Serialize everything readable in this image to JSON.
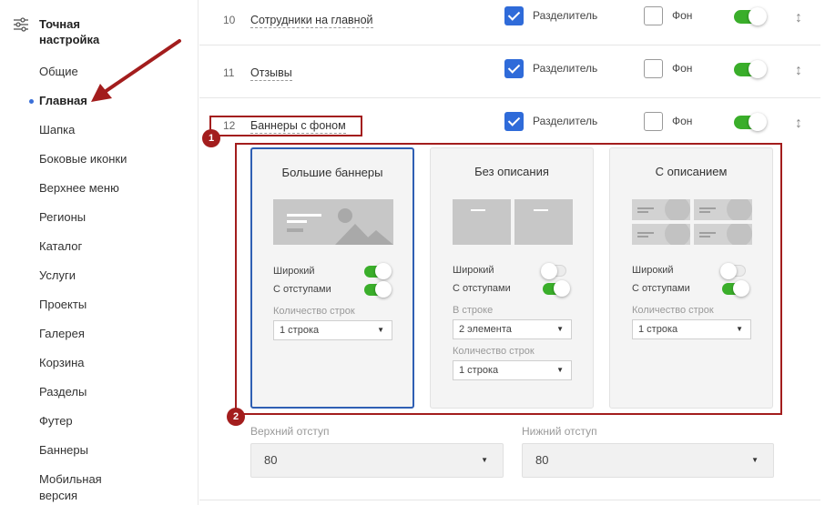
{
  "sidebar": {
    "title": "Точная настройка",
    "items": [
      {
        "label": "Общие",
        "active": false
      },
      {
        "label": "Главная",
        "active": true
      },
      {
        "label": "Шапка",
        "active": false
      },
      {
        "label": "Боковые иконки",
        "active": false
      },
      {
        "label": "Верхнее меню",
        "active": false
      },
      {
        "label": "Регионы",
        "active": false
      },
      {
        "label": "Каталог",
        "active": false
      },
      {
        "label": "Услуги",
        "active": false
      },
      {
        "label": "Проекты",
        "active": false
      },
      {
        "label": "Галерея",
        "active": false
      },
      {
        "label": "Корзина",
        "active": false
      },
      {
        "label": "Разделы",
        "active": false
      },
      {
        "label": "Футер",
        "active": false
      },
      {
        "label": "Баннеры",
        "active": false
      },
      {
        "label": "Мобильная версия",
        "active": false
      }
    ]
  },
  "rows": [
    {
      "num": "10",
      "name": "Сотрудники на главной",
      "divider_label": "Разделитель",
      "divider": true,
      "bg_label": "Фон",
      "bg": false,
      "enabled": true
    },
    {
      "num": "11",
      "name": "Отзывы",
      "divider_label": "Разделитель",
      "divider": true,
      "bg_label": "Фон",
      "bg": false,
      "enabled": true
    },
    {
      "num": "12",
      "name": "Баннеры с фоном",
      "divider_label": "Разделитель",
      "divider": true,
      "bg_label": "Фон",
      "bg": false,
      "enabled": true
    }
  ],
  "annotations": {
    "badge1": "1",
    "badge2": "2",
    "color": "#a31d1d"
  },
  "cards": [
    {
      "title": "Большие баннеры",
      "selected": true,
      "wide_label": "Широкий",
      "wide": true,
      "padding_label": "С отступами",
      "padding": true,
      "rows_label": "Количество строк",
      "rows_value": "1 строка"
    },
    {
      "title": "Без описания",
      "selected": false,
      "wide_label": "Широкий",
      "wide": false,
      "padding_label": "С отступами",
      "padding": true,
      "in_row_label": "В строке",
      "in_row_value": "2 элемента",
      "rows_label": "Количество строк",
      "rows_value": "1 строка"
    },
    {
      "title": "С описанием",
      "selected": false,
      "wide_label": "Широкий",
      "wide": false,
      "padding_label": "С отступами",
      "padding": true,
      "rows_label": "Количество строк",
      "rows_value": "1 строка"
    }
  ],
  "bottom": {
    "top_padding_label": "Верхний отступ",
    "top_padding_value": "80",
    "bottom_padding_label": "Нижний отступ",
    "bottom_padding_value": "80"
  },
  "colors": {
    "accent": "#2f6bd9",
    "toggle_on": "#3aae2a",
    "annotation": "#a31d1d"
  }
}
